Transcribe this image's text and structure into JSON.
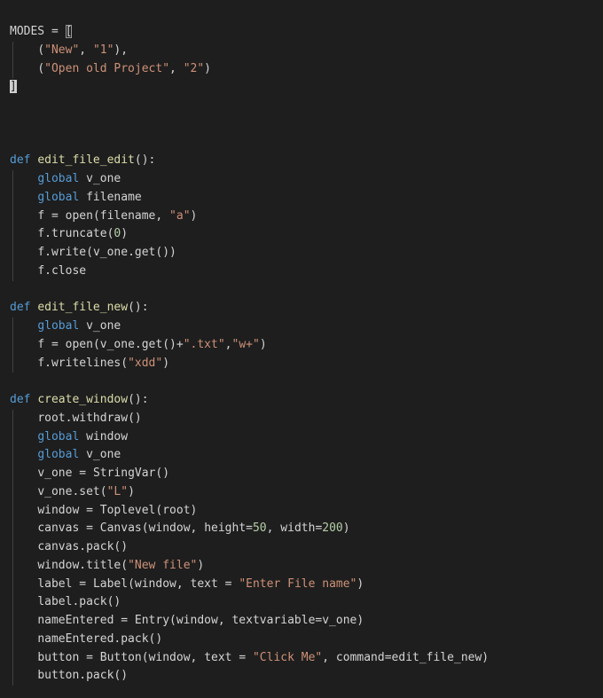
{
  "lines": [
    "MODES = [",
    "    (\"New\", \"1\"),",
    "    (\"Open old Project\", \"2\")",
    "]",
    "",
    "",
    "",
    "def edit_file_edit():",
    "    global v_one",
    "    global filename",
    "    f = open(filename, \"a\")",
    "    f.truncate(0)",
    "    f.write(v_one.get())",
    "    f.close",
    "",
    "def edit_file_new():",
    "    global v_one",
    "    f = open(v_one.get()+\".txt\",\"w+\")",
    "    f.writelines(\"xdd\")",
    "",
    "def create_window():",
    "    root.withdraw()",
    "    global window",
    "    global v_one",
    "    v_one = StringVar()",
    "    v_one.set(\"L\")",
    "    window = Toplevel(root)",
    "    canvas = Canvas(window, height=50, width=200)",
    "    canvas.pack()",
    "    window.title(\"New file\")",
    "    label = Label(window, text = \"Enter File name\")",
    "    label.pack()",
    "    nameEntered = Entry(window, textvariable=v_one)",
    "    nameEntered.pack()",
    "    button = Button(window, text = \"Click Me\", command=edit_file_new)",
    "    button.pack()"
  ],
  "colors": {
    "background": "#1e1e1e",
    "default_text": "#d4d4d4",
    "keyword": "#569cd6",
    "function": "#dcdcaa",
    "string": "#ce9178",
    "number": "#b5cea8",
    "indent_guide": "#404040"
  }
}
